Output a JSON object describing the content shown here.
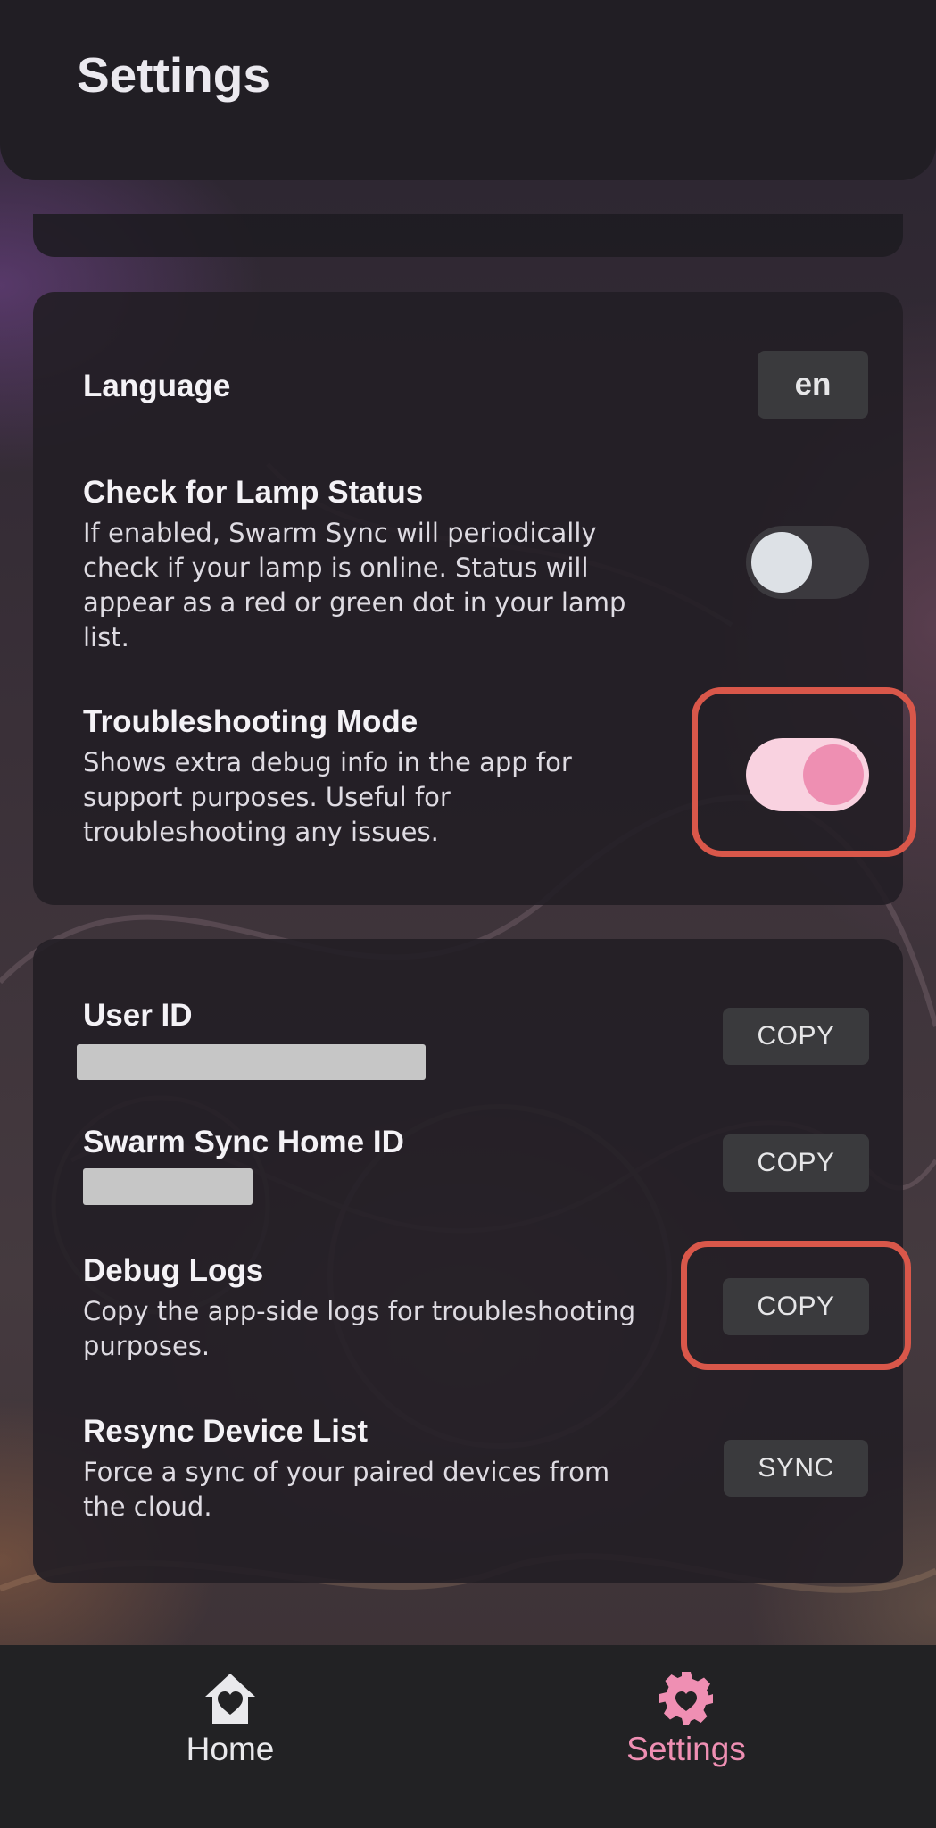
{
  "header": {
    "title": "Settings"
  },
  "preferences": {
    "language": {
      "title": "Language",
      "value": "en"
    },
    "lamp_status": {
      "title": "Check for Lamp Status",
      "description": "If enabled, Swarm Sync will periodically check if your lamp is online. Status will appear as a red or green dot in your lamp list.",
      "enabled": false
    },
    "troubleshooting": {
      "title": "Troubleshooting Mode",
      "description": "Shows extra debug info in the app for support purposes. Useful for troubleshooting any issues.",
      "enabled": true
    }
  },
  "account": {
    "user_id": {
      "title": "User ID",
      "button": "COPY"
    },
    "home_id": {
      "title": "Swarm Sync Home ID",
      "button": "COPY"
    },
    "debug_logs": {
      "title": "Debug Logs",
      "description": "Copy the app-side logs for troubleshooting purposes.",
      "button": "COPY"
    },
    "resync": {
      "title": "Resync Device List",
      "description": "Force a sync of your paired devices from the cloud.",
      "button": "SYNC"
    }
  },
  "tabbar": {
    "home": {
      "label": "Home",
      "icon": "house-heart-icon"
    },
    "settings": {
      "label": "Settings",
      "icon": "gear-heart-icon",
      "active": true
    }
  },
  "colors": {
    "accent": "#ee8fb2",
    "highlight": "#d9574a",
    "card": "#221e25"
  }
}
